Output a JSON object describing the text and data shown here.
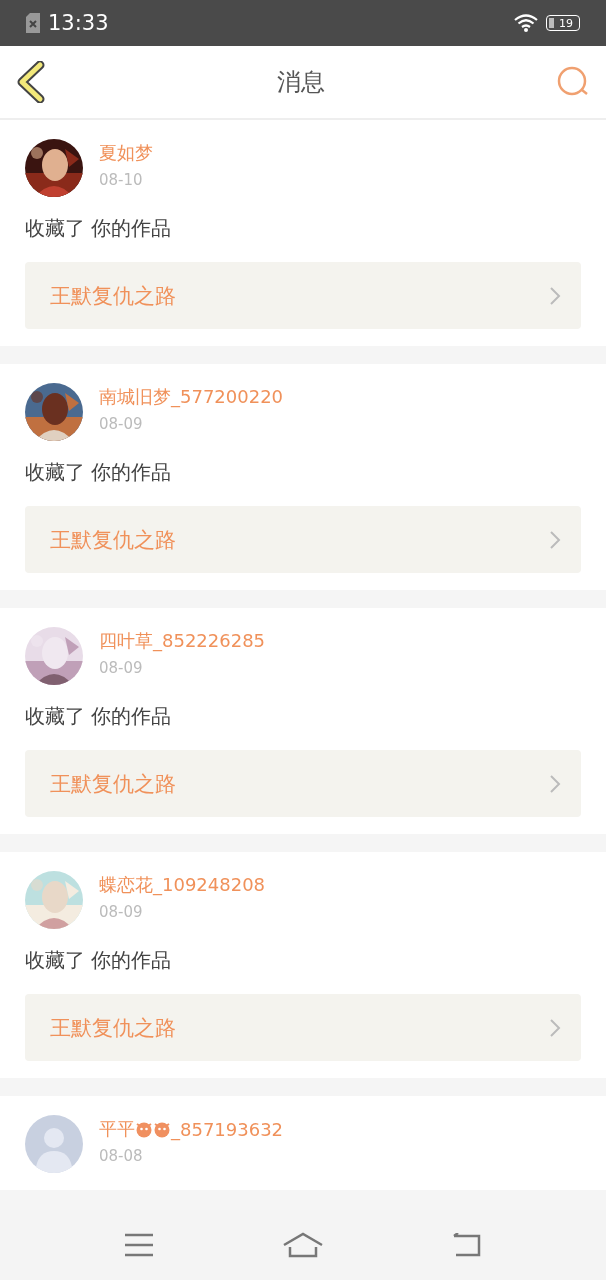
{
  "status_bar": {
    "time": "13:33",
    "battery": "19"
  },
  "header": {
    "title": "消息"
  },
  "messages": [
    {
      "user": "夏如梦",
      "date": "08-10",
      "action": "收藏了 你的作品",
      "work": "王默复仇之路"
    },
    {
      "user": "南城旧梦_577200220",
      "date": "08-09",
      "action": "收藏了 你的作品",
      "work": "王默复仇之路"
    },
    {
      "user": "四叶草_852226285",
      "date": "08-09",
      "action": "收藏了 你的作品",
      "work": "王默复仇之路"
    },
    {
      "user": "蝶恋花_109248208",
      "date": "08-09",
      "action": "收藏了 你的作品",
      "work": "王默复仇之路"
    },
    {
      "user": "平平",
      "emojis": [
        {
          "kind": "face"
        },
        {
          "kind": "face"
        }
      ],
      "user_suffix": "_857193632",
      "date": "08-08",
      "avatar": {
        "kind": "placeholder"
      }
    }
  ]
}
